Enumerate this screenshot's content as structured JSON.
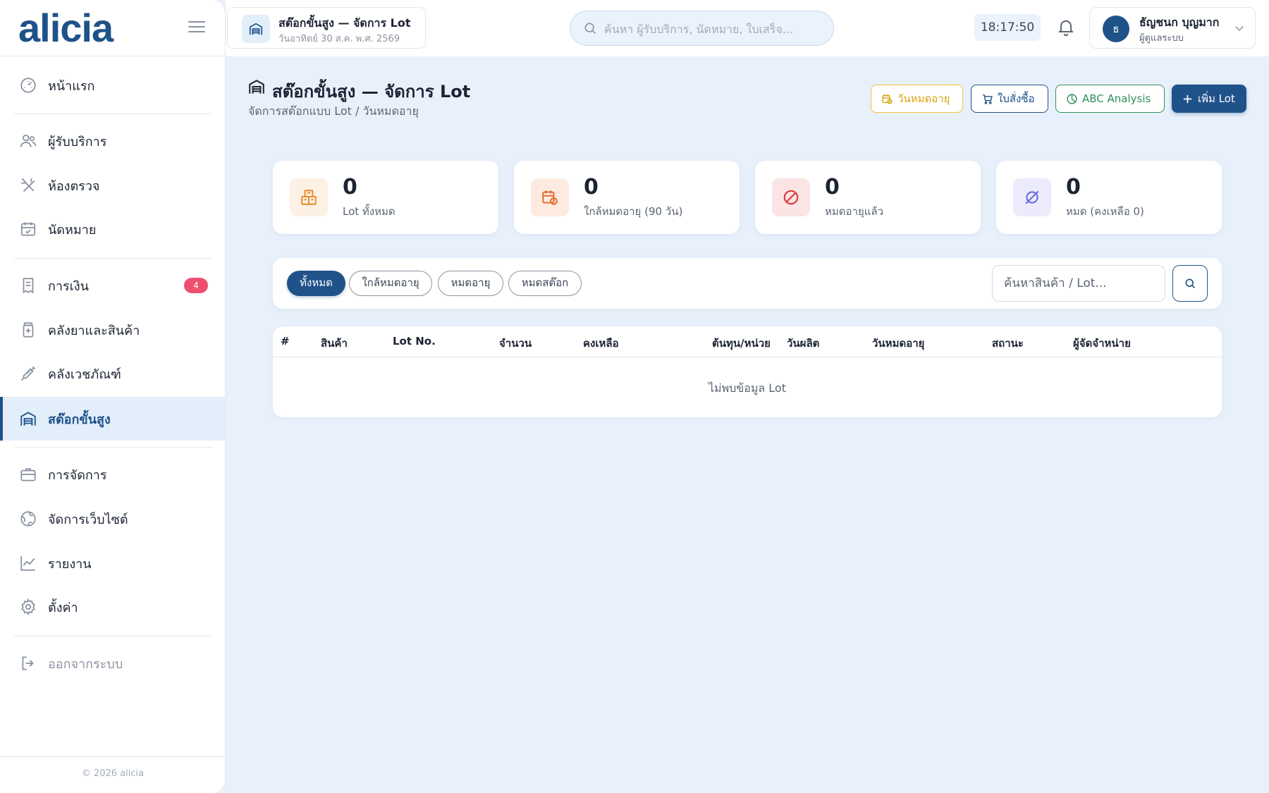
{
  "brand": {
    "name": "alicia"
  },
  "sidebar": {
    "items": [
      {
        "label": "หน้าแรก",
        "icon": "dashboard-icon"
      },
      {
        "label": "ผู้รับบริการ",
        "icon": "users-icon"
      },
      {
        "label": "ห้องตรวจ",
        "icon": "stethoscope-icon"
      },
      {
        "label": "นัดหมาย",
        "icon": "calendar-check-icon"
      },
      {
        "label": "การเงิน",
        "icon": "receipt-icon",
        "badge": "4"
      },
      {
        "label": "คลังยาและสินค้า",
        "icon": "medicine-bottle-icon"
      },
      {
        "label": "คลังเวชภัณฑ์",
        "icon": "syringe-icon"
      },
      {
        "label": "สต๊อกขั้นสูง",
        "icon": "warehouse-icon",
        "active": true
      },
      {
        "label": "การจัดการ",
        "icon": "briefcase-icon"
      },
      {
        "label": "จัดการเว็บไซต์",
        "icon": "globe-icon"
      },
      {
        "label": "รายงาน",
        "icon": "chart-line-icon"
      },
      {
        "label": "ตั้งค่า",
        "icon": "gear-icon"
      },
      {
        "label": "ออกจากระบบ",
        "icon": "logout-icon"
      }
    ],
    "footer": "© 2026 alicia"
  },
  "topbar": {
    "crumb_title": "สต๊อกขั้นสูง — จัดการ Lot",
    "crumb_date": "วันอาทิตย์ 30 ส.ค. พ.ศ. 2569",
    "search_placeholder": "ค้นหา ผู้รับบริการ, นัดหมาย, ใบเสร็จ...",
    "clock": "18:17:50",
    "user": {
      "initial": "ธ",
      "name": "ธัญชนก บุญมาก",
      "role": "ผู้ดูแลระบบ"
    }
  },
  "page": {
    "title": "สต๊อกขั้นสูง — จัดการ Lot",
    "subtitle": "จัดการสต๊อกแบบ Lot / วันหมดอายุ",
    "actions": {
      "expiry": "วันหมดอายุ",
      "purchase_order": "ใบสั่งซื้อ",
      "abc": "ABC Analysis",
      "add_lot": "เพิ่ม Lot"
    }
  },
  "stats": [
    {
      "value": "0",
      "label": "Lot ทั้งหมด",
      "color": "#e8892a",
      "bg": "#fdf0e4"
    },
    {
      "value": "0",
      "label": "ใกล้หมดอายุ (90 วัน)",
      "color": "#e06a2c",
      "bg": "#fdebe2"
    },
    {
      "value": "0",
      "label": "หมดอายุแล้ว",
      "color": "#d93b3b",
      "bg": "#fbe4e4"
    },
    {
      "value": "0",
      "label": "หมด (คงเหลือ 0)",
      "color": "#6b6fe0",
      "bg": "#ebebfb"
    }
  ],
  "filters": {
    "chips": [
      "ทั้งหมด",
      "ใกล้หมดอายุ",
      "หมดอายุ",
      "หมดสต๊อก"
    ],
    "active_index": 0,
    "search_placeholder": "ค้นหาสินค้า / Lot..."
  },
  "table": {
    "columns": [
      "#",
      "สินค้า",
      "Lot No.",
      "จำนวน",
      "คงเหลือ",
      "ต้นทุน/หน่วย",
      "วันผลิต",
      "วันหมดอายุ",
      "สถานะ",
      "ผู้จัดจำหน่าย"
    ],
    "rows": [],
    "empty_text": "ไม่พบข้อมูล Lot"
  },
  "colors": {
    "primary": "#1f5289",
    "danger_badge": "#ee4f6f",
    "warning": "#f0c233",
    "success": "#2f8f57",
    "background": "#e8f1fb"
  }
}
